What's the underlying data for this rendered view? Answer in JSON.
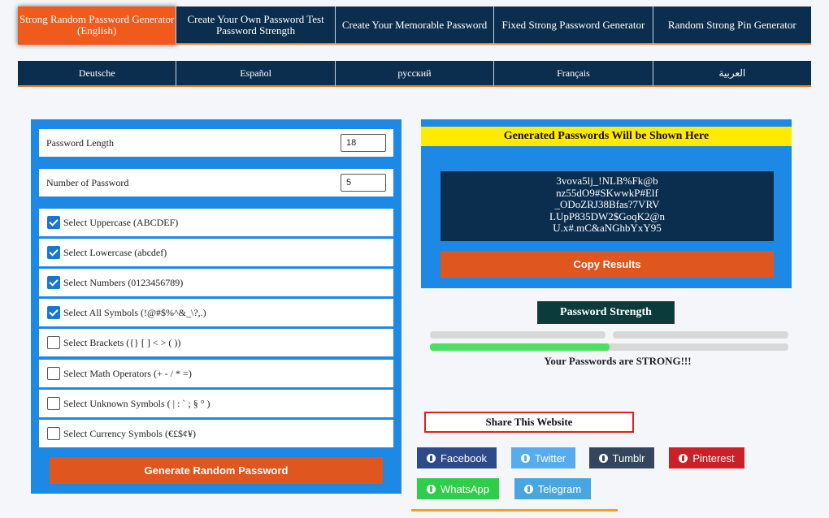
{
  "nav_top": [
    {
      "label": "Strong Random Password Generator (English)",
      "active": true
    },
    {
      "label": "Create Your Own Password Test Password Strength",
      "active": false
    },
    {
      "label": "Create Your Memorable Password",
      "active": false
    },
    {
      "label": "Fixed Strong Password Generator",
      "active": false
    },
    {
      "label": "Random Strong Pin Generator",
      "active": false
    }
  ],
  "nav_lang": [
    "Deutsche",
    "Español",
    "русский",
    "Français",
    "العربية"
  ],
  "settings": {
    "length_label": "Password Length",
    "length_value": "18",
    "count_label": "Number of Password",
    "count_value": "5",
    "options": [
      {
        "label": "Select Uppercase (ABCDEF)",
        "checked": true
      },
      {
        "label": "Select Lowercase (abcdef)",
        "checked": true
      },
      {
        "label": "Select Numbers (0123456789)",
        "checked": true
      },
      {
        "label": "Select All Symbols (!@#$%^&_\\?,.)",
        "checked": true
      },
      {
        "label": "Select Brackets ({} [ ] < > ( ))",
        "checked": false
      },
      {
        "label": "Select Math Operators (+ - / * =)",
        "checked": false
      },
      {
        "label": "Select Unknown Symbols ( | : ` ; § ° )",
        "checked": false
      },
      {
        "label": "Select Currency Symbols (€£$¢¥)",
        "checked": false
      }
    ],
    "generate_label": "Generate Random Password"
  },
  "results": {
    "banner": "Generated Passwords Will be Shown Here",
    "passwords": [
      "3vova5lj_!NLB%Fk@b",
      "nz55dO9#SKwwkP#Elf",
      "_ODoZRJ38Bfas?7VRV",
      "LUpP835DW2$GoqK2@n",
      "U.x#.mC&aNGhbYxY95"
    ],
    "copy_label": "Copy Results"
  },
  "strength": {
    "title": "Password Strength",
    "level": 0.5,
    "message": "Your Passwords are STRONG!!!"
  },
  "share": {
    "title": "Share This Website",
    "buttons": [
      {
        "label": "Facebook",
        "color": "#2d4a8a",
        "icon": "facebook-icon"
      },
      {
        "label": "Twitter",
        "color": "#55acee",
        "icon": "twitter-icon"
      },
      {
        "label": "Tumblr",
        "color": "#34465d",
        "icon": "tumblr-icon"
      },
      {
        "label": "Pinterest",
        "color": "#cb2027",
        "icon": "pinterest-icon"
      },
      {
        "label": "WhatsApp",
        "color": "#2fce4a",
        "icon": "whatsapp-icon"
      },
      {
        "label": "Telegram",
        "color": "#4aa6e0",
        "icon": "telegram-icon"
      }
    ]
  }
}
